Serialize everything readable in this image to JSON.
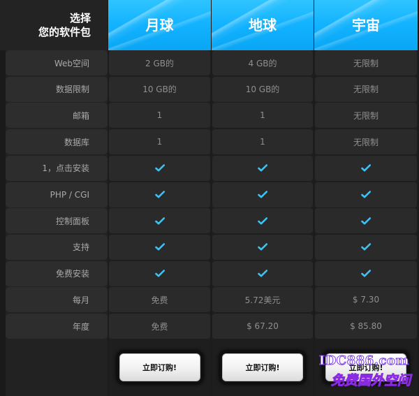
{
  "header": {
    "corner_line1": "选择",
    "corner_line2": "您的软件包",
    "plans": [
      "月球",
      "地球",
      "宇宙"
    ]
  },
  "rows": [
    {
      "label": "Web空间",
      "values": [
        "2 GB的",
        "4 GB的",
        "无限制"
      ]
    },
    {
      "label": "数据限制",
      "values": [
        "10 GB的",
        "10 GB的",
        "无限制"
      ]
    },
    {
      "label": "邮箱",
      "values": [
        "1",
        "1",
        "无限制"
      ]
    },
    {
      "label": "数据库",
      "values": [
        "1",
        "1",
        "无限制"
      ]
    },
    {
      "label": "1，点击安装",
      "values": [
        "check",
        "check",
        "check"
      ]
    },
    {
      "label": "PHP / CGI",
      "values": [
        "check",
        "check",
        "check"
      ]
    },
    {
      "label": "控制面板",
      "values": [
        "check",
        "check",
        "check"
      ]
    },
    {
      "label": "支持",
      "values": [
        "check",
        "check",
        "check"
      ]
    },
    {
      "label": "免费安装",
      "values": [
        "check",
        "check",
        "check"
      ]
    },
    {
      "label": "每月",
      "values": [
        "免费",
        "5.72美元",
        "$ 7.30"
      ]
    },
    {
      "label": "年度",
      "values": [
        "免费",
        "$ 67.20",
        "$ 85.80"
      ]
    }
  ],
  "buttons": [
    "立即订购!",
    "立即订购!",
    "立即订购!"
  ],
  "icons": {
    "check": "checkmark-icon"
  },
  "colors": {
    "accent": "#12b2ff",
    "check": "#3cc3f2"
  },
  "watermark": {
    "domain": "IDC886.com",
    "slogan": "免费国外空间"
  }
}
